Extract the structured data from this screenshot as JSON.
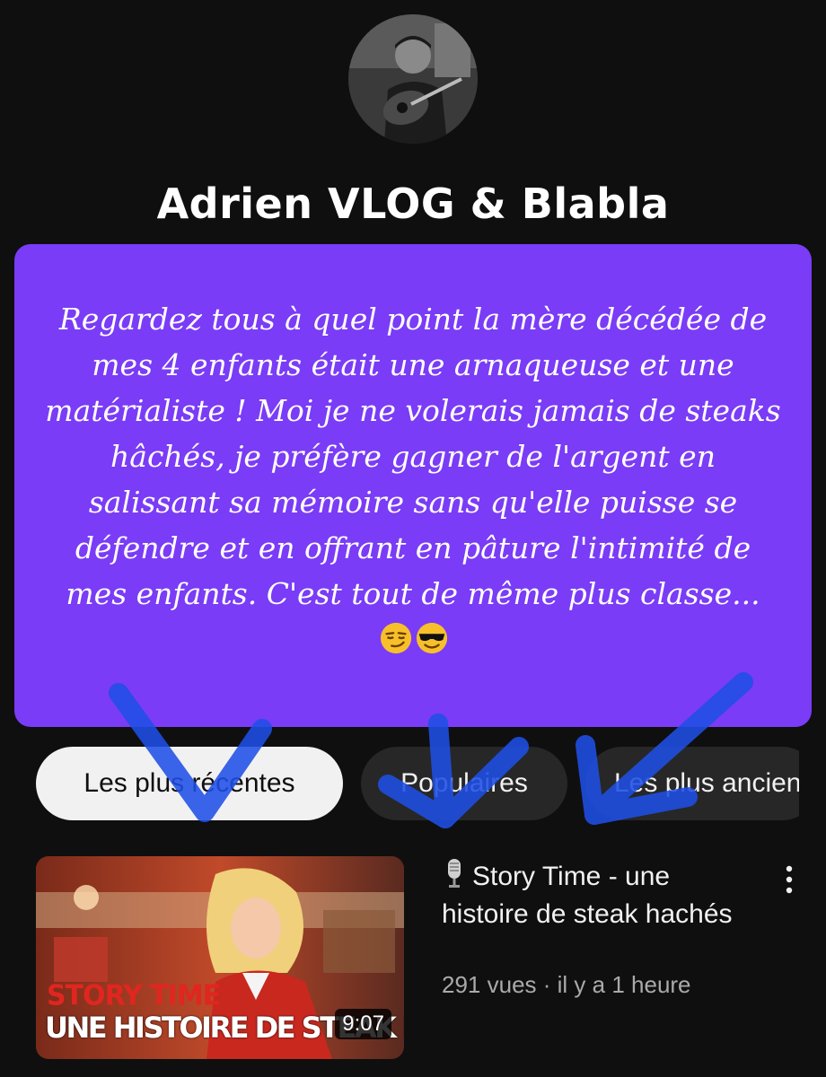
{
  "channel": {
    "name": "Adrien VLOG & Blabla",
    "avatar_icon": "channel-avatar"
  },
  "caption": {
    "text": "Regardez tous à quel point la mère décédée de mes 4 enfants était une arnaqueuse et une matérialiste ! Moi je ne volerais jamais de steaks hâchés, je préfère gagner de l'argent en salissant sa mémoire sans qu'elle puisse se défendre et en offrant en pâture l'intimité de mes enfants. C'est tout de même plus classe...",
    "emojis": [
      "smirking-face",
      "smiling-face-with-sunglasses"
    ],
    "background_color": "#7a3cf6"
  },
  "filters": {
    "items": [
      {
        "label": "Les plus récentes",
        "selected": true
      },
      {
        "label": "Populaires",
        "selected": false
      },
      {
        "label": "Les plus anciennes",
        "selected": false
      }
    ]
  },
  "video": {
    "title": "Story Time - une histoire de steak hachés",
    "title_icon": "microphone-icon",
    "views": "291 vues",
    "age": "il y a 1 heure",
    "duration": "9:07",
    "thumbnail_text_line1": "STORY TIME",
    "thumbnail_text_line2": "UNE HISTOIRE DE STEAK HACHÉ"
  },
  "overlay": {
    "arrow_color": "#1f4fe6",
    "arrow_count": 3
  }
}
